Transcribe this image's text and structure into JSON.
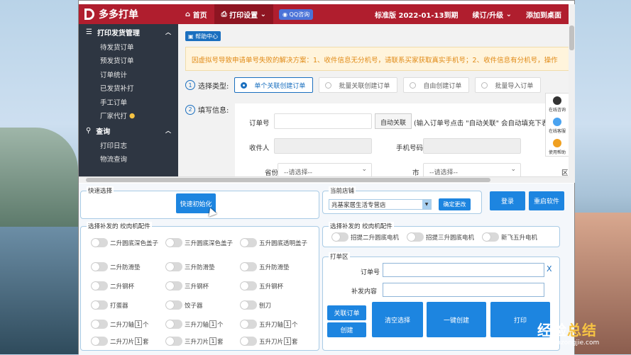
{
  "app": {
    "logo_text": "多多打单",
    "nav": {
      "home": "首页",
      "print_settings": "打印设置",
      "qq": "QQ咨询",
      "edition": "标准版 2022-01-13到期",
      "renew": "续订/升级",
      "add_desktop": "添加到桌面"
    }
  },
  "sidebar": {
    "group1": "打印发货管理",
    "items1": [
      "待发货订单",
      "预发货订单",
      "订单统计",
      "已发货补打",
      "手工订单",
      "厂家代打"
    ],
    "group2": "查询",
    "items2": [
      "打印日志",
      "物流查询"
    ]
  },
  "main": {
    "help": "帮助中心",
    "notice": "因虚拟号导致申请单号失败的解决方案：1、收件信息无分机号，请联系买家获取真实手机号；2、收件信息有分机号，操作",
    "step1_label": "选择类型:",
    "types": [
      "单个关联创建订单",
      "批量关联创建订单",
      "自由创建订单",
      "批量导入订单"
    ],
    "step2_label": "填写信息:",
    "form": {
      "order_no_label": "订单号",
      "auto_link_btn": "自动关联",
      "auto_link_hint": "(输入订单号点击 \"自动关联\" 会自动填充下表",
      "receiver_label": "收件人",
      "phone_label": "手机号码",
      "province_label": "省份",
      "province_placeholder": "--请选择--",
      "city_label": "市",
      "city_placeholder": "--请选择--",
      "district_label": "区"
    },
    "float": [
      "在线咨询",
      "在线客服",
      "使用帮助"
    ]
  },
  "tool": {
    "quick_select_title": "快速选择",
    "quick_init_btn": "快速初始化",
    "store_title": "当前店铺",
    "store_value": "兆基家居生活专营店",
    "confirm_change_btn": "确定更改",
    "login_btn": "登录",
    "restart_btn": "重启软件",
    "parts_title": "选择补发的 绞肉机配件",
    "parts": [
      [
        "二升圆底深色盖子",
        "三升圆底深色盖子",
        "五升圆底透明盖子"
      ],
      [
        "二升防滑垫",
        "三升防滑垫",
        "五升防滑垫"
      ],
      [
        "二升钢杯",
        "三升钢杯",
        "五升钢杯"
      ],
      [
        "打蛋器",
        "饺子器",
        "刨刀"
      ]
    ],
    "blade_rows": [
      {
        "prefixes": [
          "二升刀轴",
          "三升刀轴",
          "五升刀轴"
        ],
        "qty": "1",
        "unit": "个"
      },
      {
        "prefixes": [
          "二升刀片",
          "三升刀片",
          "五升刀片"
        ],
        "qty": "1",
        "unit": "套"
      }
    ],
    "motor_title": "选择补发的 绞肉机配件",
    "motors": [
      "招提二升圆底电机",
      "招提三升圆底电机",
      "新飞五升电机"
    ],
    "print_title": "打单区",
    "order_no_label": "订单号",
    "clear_x": "X",
    "reissue_label": "补发内容",
    "link_order_btn": "关联订单",
    "create_btn": "创建",
    "clear_btn": "清空选择",
    "one_click_btn": "一键创建",
    "print_btn": "打印"
  },
  "watermark": {
    "line1_a": "经验",
    "line1_b": "总结",
    "line2": "jingyanzongjie.com"
  }
}
